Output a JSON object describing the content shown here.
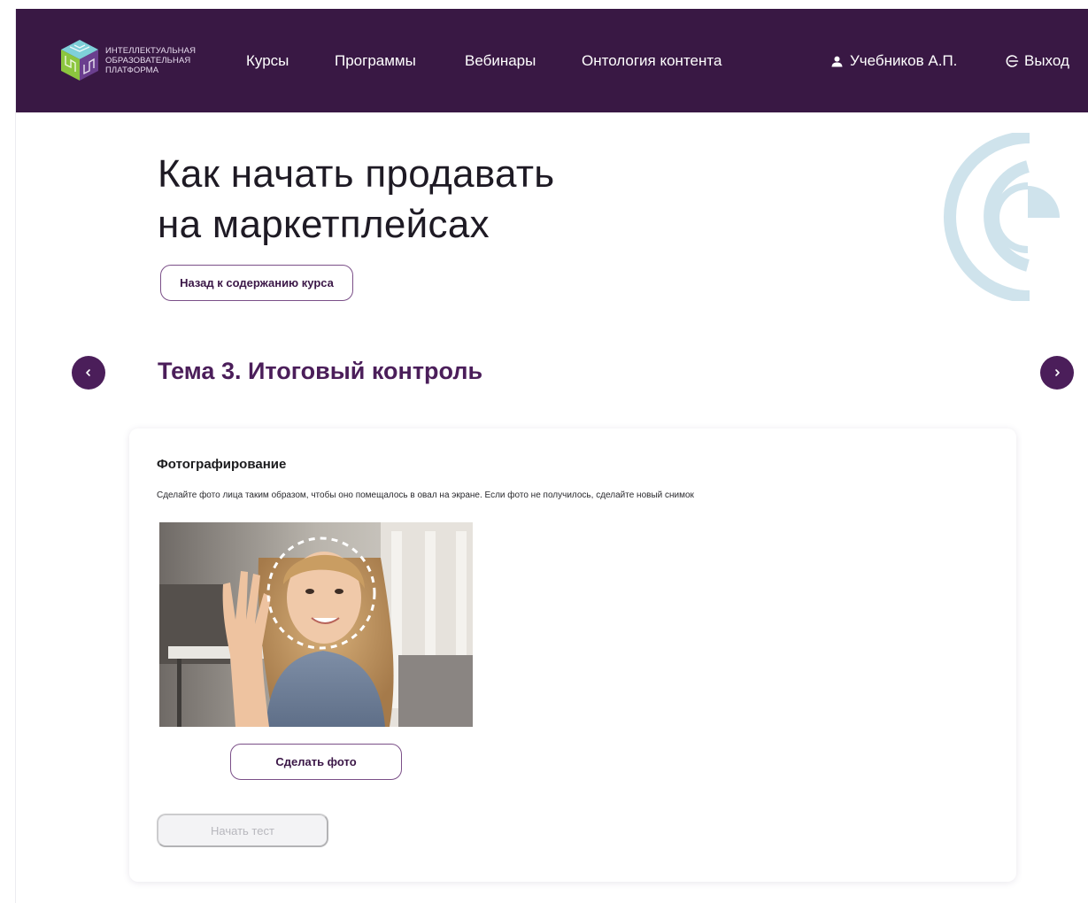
{
  "header": {
    "logo_lines": [
      "Интеллектуальная",
      "образовательная",
      "платформа"
    ],
    "nav": [
      {
        "label": "Курсы",
        "icon": "none"
      },
      {
        "label": "Программы",
        "icon": "none"
      },
      {
        "label": "Вебинары",
        "icon": "none"
      },
      {
        "label": "Онтология контента",
        "icon": "none"
      }
    ],
    "user": {
      "name": "Учебников А.П.",
      "icon": "user-icon"
    },
    "logout": {
      "label": "Выход",
      "icon": "logout-icon"
    },
    "bg_color": "#391844"
  },
  "page": {
    "title_lines": [
      "Как начать продавать",
      "на маркетплейсах"
    ],
    "back_button": "Назад к содержанию курса",
    "topic_title": "Тема 3. Итоговый контроль",
    "prev_icon": "chevron-left-icon",
    "next_icon": "chevron-right-icon",
    "accent_color": "#4b1e5a",
    "deco_color": "#cfe3ec"
  },
  "card": {
    "title": "Фотографирование",
    "description": "Сделайте фото лица таким образом, чтобы оно помещалось в овал на экране. Если фото не получилось, сделайте новый снимок",
    "take_photo_button": "Сделать фото",
    "start_test_button": "Начать тест",
    "start_test_disabled": true
  }
}
